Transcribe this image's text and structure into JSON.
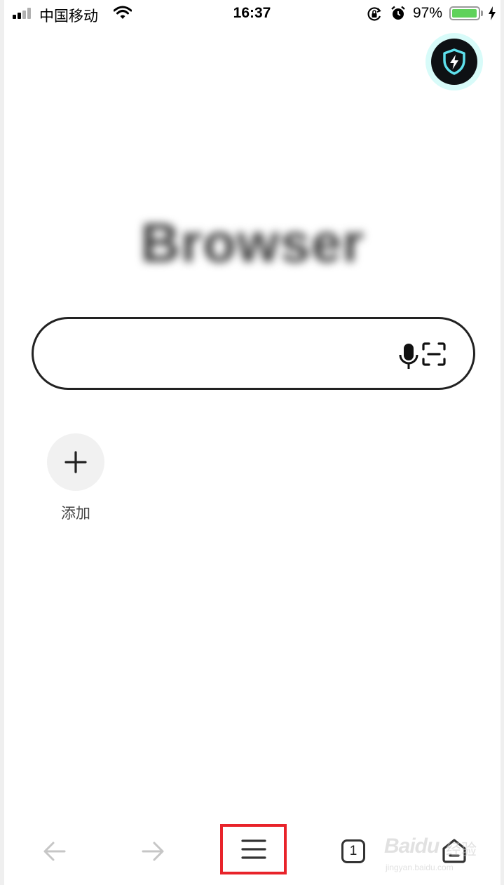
{
  "status_bar": {
    "carrier": "中国移动",
    "time": "16:37",
    "battery_percent": "97%",
    "battery_level": 0.97,
    "signal_bars": 4,
    "signal_strength": 2,
    "icons": [
      "wifi-icon",
      "orientation-lock-icon",
      "alarm-icon",
      "charging-bolt-icon"
    ]
  },
  "header": {
    "shield_icon": "security-shield-bolt-icon",
    "shield_color": "#0e1114",
    "shield_ring_color": "#d8fbf9"
  },
  "logo": {
    "text": "Browser"
  },
  "search": {
    "placeholder": "",
    "mic_icon": "microphone-icon",
    "scan_icon": "scan-icon"
  },
  "shortcuts": {
    "add_label": "添加"
  },
  "toolbar": {
    "items": [
      "back-arrow-icon",
      "forward-arrow-icon",
      "menu-icon",
      "tabs-icon",
      "home-icon"
    ],
    "tab_count": "1",
    "highlight_color": "#e8232a"
  },
  "watermark": {
    "brand": "Baidu",
    "brand_cn": "经验",
    "url": "jingyan.baidu.com"
  }
}
